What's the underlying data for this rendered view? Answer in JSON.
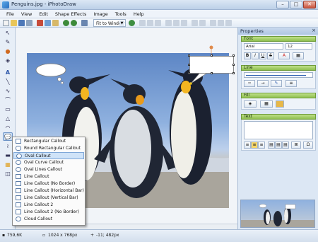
{
  "window": {
    "title": "Penguins.jpg - iPhotoDraw"
  },
  "menubar": [
    "File",
    "View",
    "Edit",
    "Shape Effects",
    "Image",
    "Tools",
    "Help"
  ],
  "toolbar": {
    "zoom_select": "Fit to Window"
  },
  "properties": {
    "title": "Properties",
    "close": "×",
    "font": {
      "header": "Font",
      "family": "Arial",
      "size": "12",
      "bold": "B",
      "italic": "I",
      "underline": "U",
      "strike": "S",
      "color_btn": "A"
    },
    "line": {
      "header": "Line"
    },
    "fill": {
      "header": "Fill"
    },
    "text": {
      "header": "Text",
      "value": ""
    }
  },
  "callout_menu": [
    {
      "label": "Rectangular Callout",
      "icon": "rect-callout-icon"
    },
    {
      "label": "Round Rectangular Callout",
      "icon": "round-rect-callout-icon"
    },
    {
      "label": "Oval Callout",
      "icon": "oval-callout-icon",
      "highlighted": true
    },
    {
      "label": "Oval Curve Callout",
      "icon": "oval-curve-callout-icon"
    },
    {
      "label": "Oval Lines Callout",
      "icon": "oval-lines-callout-icon"
    },
    {
      "label": "Line Callout",
      "icon": "line-callout-icon"
    },
    {
      "label": "Line Callout (No Border)",
      "icon": "line-callout-no-border-icon"
    },
    {
      "label": "Line Callout (Horizontal Bar)",
      "icon": "line-callout-horizontal-bar-icon"
    },
    {
      "label": "Line Callout (Vertical Bar)",
      "icon": "line-callout-vertical-bar-icon"
    },
    {
      "label": "Line Callout 2",
      "icon": "line-callout-2-icon"
    },
    {
      "label": "Line Callout 2 (No Border)",
      "icon": "line-callout-2-no-border-icon"
    },
    {
      "label": "Cloud Callout",
      "icon": "cloud-callout-icon"
    }
  ],
  "status": {
    "filesize": "759,6K",
    "dimensions": "1024 x 768px",
    "cursor": "-11; 482px"
  }
}
